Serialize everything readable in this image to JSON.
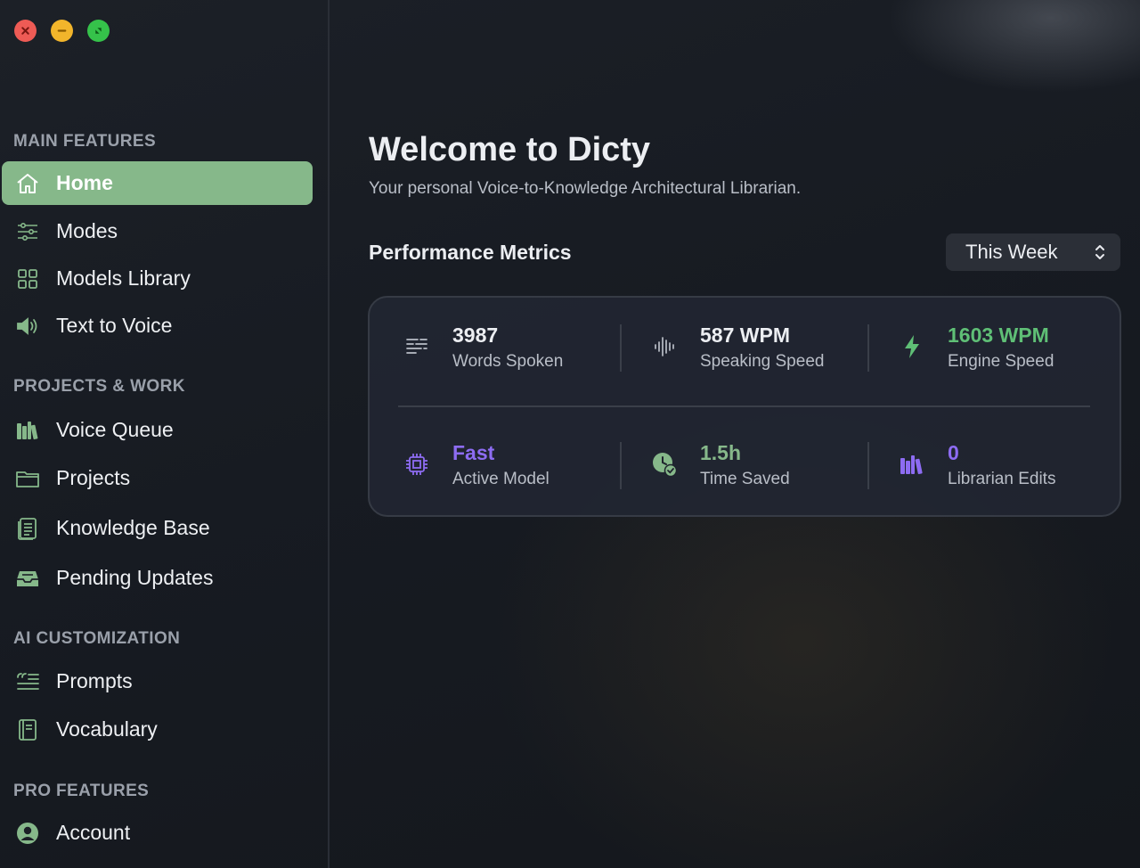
{
  "window": {
    "controls": {
      "close_icon": "close-icon",
      "minimize_icon": "minimize-icon",
      "zoom_icon": "fullscreen-icon"
    }
  },
  "colors": {
    "accent_green": "#86b88a",
    "metric_green": "#5fbf76",
    "metric_purple": "#8d6cf2"
  },
  "sidebar": {
    "sections": [
      {
        "title": "MAIN FEATURES"
      },
      {
        "title": "PROJECTS & WORK"
      },
      {
        "title": "AI CUSTOMIZATION"
      },
      {
        "title": "PRO FEATURES"
      }
    ],
    "items": [
      {
        "label": "Home",
        "icon": "home-icon",
        "active": true
      },
      {
        "label": "Modes",
        "icon": "sliders-icon"
      },
      {
        "label": "Models Library",
        "icon": "grid-icon"
      },
      {
        "label": "Text to Voice",
        "icon": "speaker-icon"
      },
      {
        "label": "Voice Queue",
        "icon": "books-icon"
      },
      {
        "label": "Projects",
        "icon": "folder-icon"
      },
      {
        "label": "Knowledge Base",
        "icon": "document-icon"
      },
      {
        "label": "Pending Updates",
        "icon": "tray-icon"
      },
      {
        "label": "Prompts",
        "icon": "quote-list-icon"
      },
      {
        "label": "Vocabulary",
        "icon": "book-icon"
      },
      {
        "label": "Account",
        "icon": "user-circle-icon"
      }
    ]
  },
  "main": {
    "title": "Welcome to Dicty",
    "subtitle": "Your personal Voice-to-Knowledge Architectural Librarian.",
    "performance_title": "Performance Metrics",
    "period_select": {
      "value": "This Week"
    },
    "metrics": [
      {
        "value": "3987",
        "label": "Words Spoken",
        "icon": "text-lines-icon"
      },
      {
        "value": "587 WPM",
        "label": "Speaking Speed",
        "icon": "waveform-icon"
      },
      {
        "value": "1603 WPM",
        "label": "Engine Speed",
        "icon": "bolt-icon"
      },
      {
        "value": "Fast",
        "label": "Active Model",
        "icon": "cpu-icon"
      },
      {
        "value": "1.5h",
        "label": "Time Saved",
        "icon": "clock-check-icon"
      },
      {
        "value": "0",
        "label": "Librarian Edits",
        "icon": "books-icon"
      }
    ]
  }
}
